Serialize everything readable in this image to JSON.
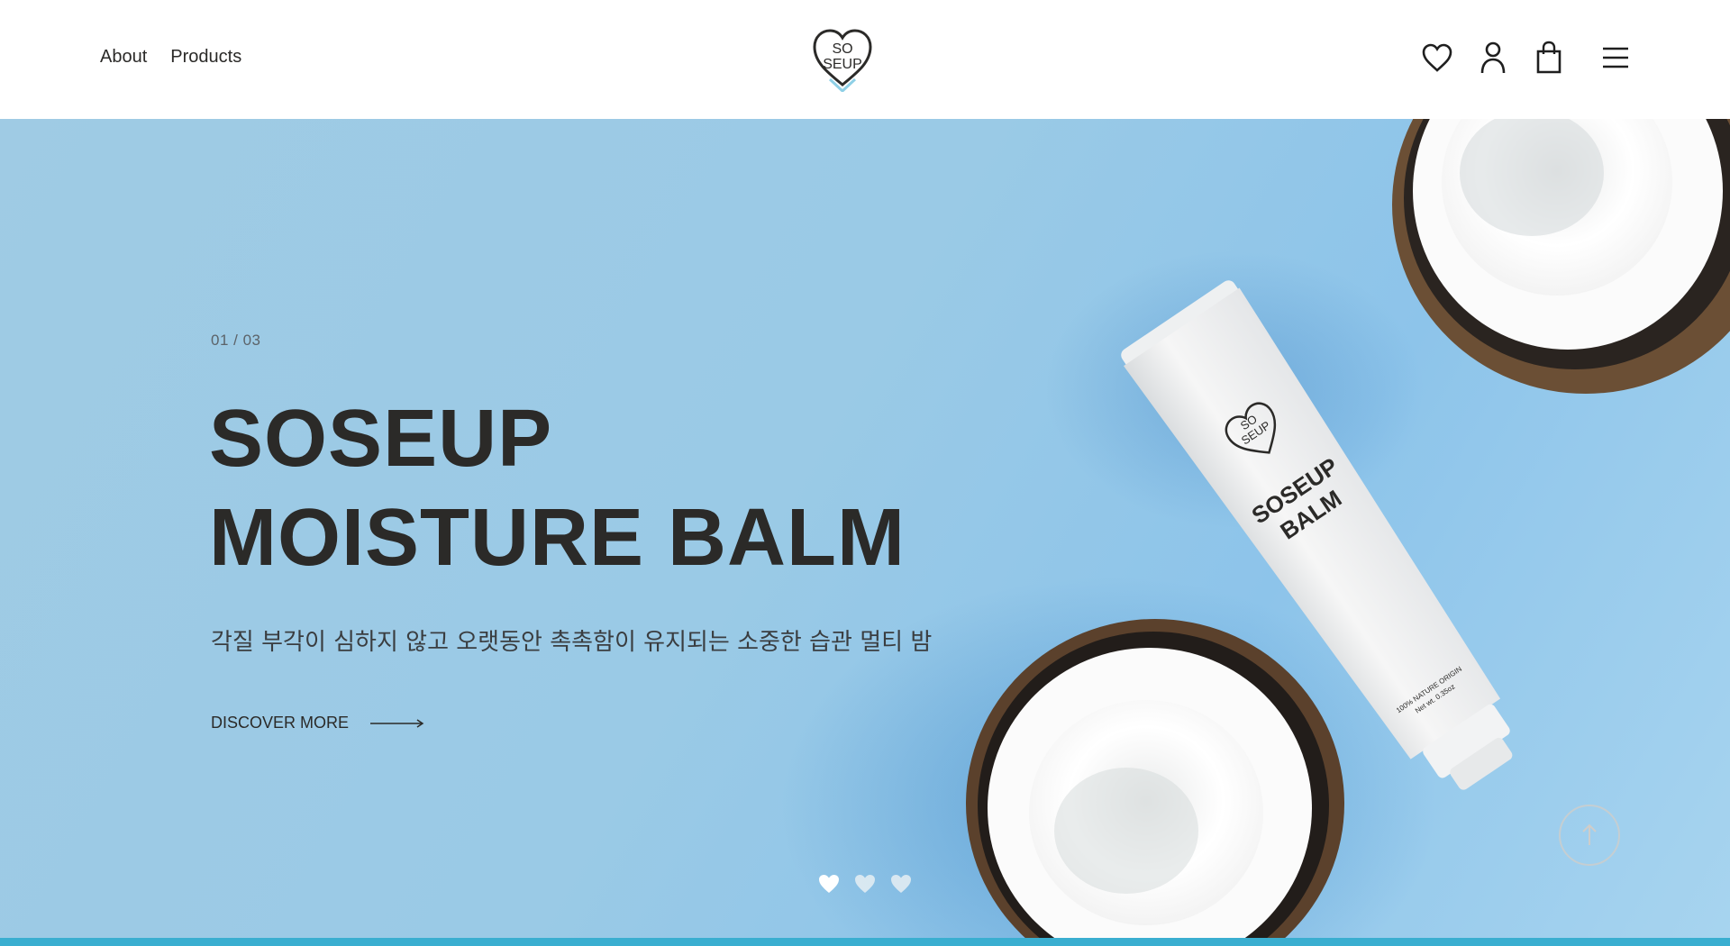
{
  "header": {
    "nav": [
      {
        "label": "About"
      },
      {
        "label": "Products"
      }
    ],
    "logo_text_top": "SO",
    "logo_text_bottom": "SEUP",
    "icons": [
      "heart-icon",
      "user-icon",
      "shopping-bag-icon",
      "menu-icon"
    ]
  },
  "hero": {
    "counter": "01 / 03",
    "title_line1": "SOSEUP",
    "title_line2": "MOISTURE BALM",
    "subtitle": "각질 부각이 심하지 않고 오랫동안 촉촉함이 유지되는 소중한 습관 멀티 밤",
    "cta_label": "DISCOVER MORE",
    "tube_label_line1": "SOSEUP",
    "tube_label_line2": "BALM",
    "tube_fine_print_line1": "100% NATURE ORIGIN",
    "tube_fine_print_line2": "Net wt. 0.35oz",
    "slides": 3,
    "active_slide": 1
  },
  "colors": {
    "accent": "#3aaed0",
    "hero_background": "#9fcbe4",
    "text_dark": "#2b2a28"
  }
}
